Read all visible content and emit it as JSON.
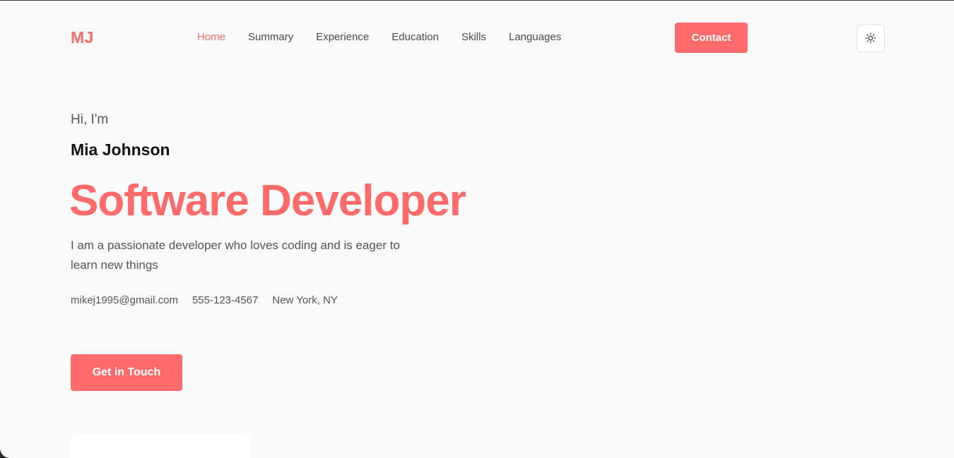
{
  "header": {
    "logo": "MJ",
    "nav": [
      {
        "label": "Home",
        "active": true
      },
      {
        "label": "Summary",
        "active": false
      },
      {
        "label": "Experience",
        "active": false
      },
      {
        "label": "Education",
        "active": false
      },
      {
        "label": "Skills",
        "active": false
      },
      {
        "label": "Languages",
        "active": false
      }
    ],
    "contact_label": "Contact",
    "theme_toggle_icon": "sun-icon"
  },
  "hero": {
    "greeting": "Hi, I'm",
    "name": "Mia Johnson",
    "role": "Software Developer",
    "bio": "I am a passionate developer who loves coding and is eager to learn new things",
    "email": "mikej1995@gmail.com",
    "phone": "555-123-4567",
    "location": "New York, NY",
    "cta_label": "Get in Touch"
  },
  "colors": {
    "accent": "#ff6b6b",
    "background": "#fafafa",
    "text_primary": "#111111",
    "text_secondary": "#555555"
  }
}
